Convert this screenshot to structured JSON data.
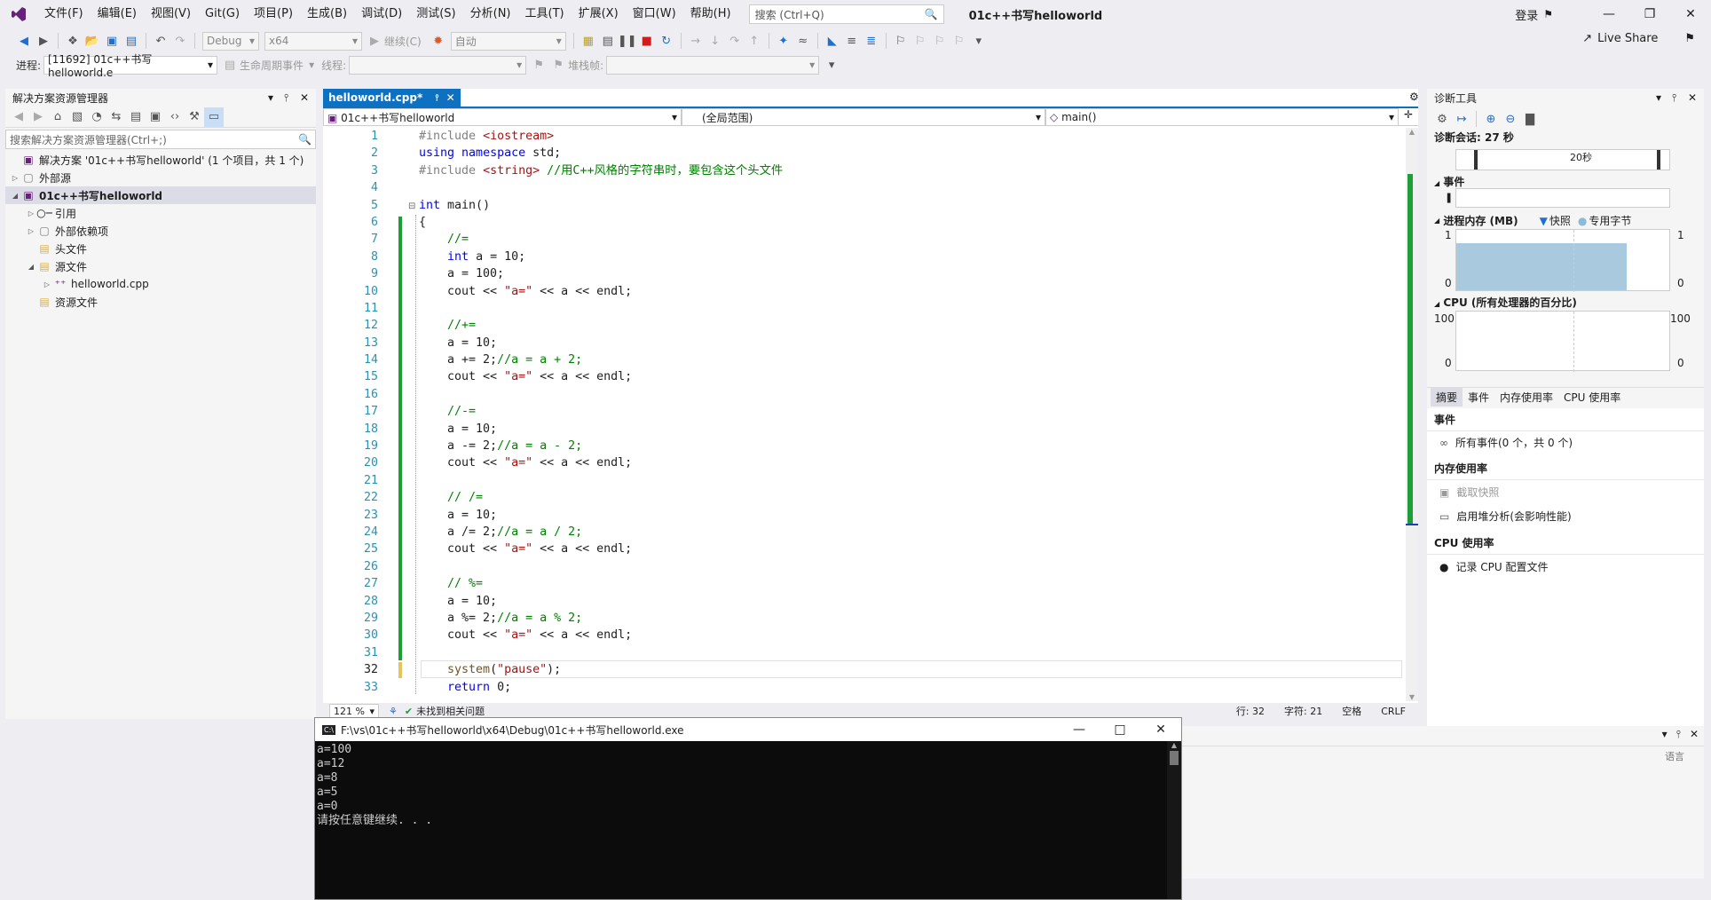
{
  "menubar": {
    "items": [
      "文件(F)",
      "编辑(E)",
      "视图(V)",
      "Git(G)",
      "项目(P)",
      "生成(B)",
      "调试(D)",
      "测试(S)",
      "分析(N)",
      "工具(T)",
      "扩展(X)",
      "窗口(W)",
      "帮助(H)"
    ],
    "search_placeholder": "搜索 (Ctrl+Q)",
    "title": "01c++书写helloworld",
    "signin": "登录",
    "live_share": "Live Share"
  },
  "toolbar": {
    "config": "Debug",
    "platform": "x64",
    "continue": "继续(C)",
    "auto": "自动"
  },
  "toolbar2": {
    "process_label": "进程:",
    "process_value": "[11692] 01c++书写helloworld.e",
    "lifecycle": "生命周期事件",
    "thread_label": "线程:",
    "stack_label": "堆栈帧:"
  },
  "solution": {
    "header": "解决方案资源管理器",
    "search_placeholder": "搜索解决方案资源管理器(Ctrl+;)",
    "items": [
      {
        "label": "解决方案 '01c++书写helloworld' (1 个项目，共 1 个)",
        "indent": 0,
        "arrow": ""
      },
      {
        "label": "外部源",
        "indent": 0,
        "arrow": "▷"
      },
      {
        "label": "01c++书写helloworld",
        "indent": 0,
        "arrow": "◢",
        "bold": true
      },
      {
        "label": "引用",
        "indent": 1,
        "arrow": "▷"
      },
      {
        "label": "外部依赖项",
        "indent": 1,
        "arrow": "▷"
      },
      {
        "label": "头文件",
        "indent": 1,
        "arrow": ""
      },
      {
        "label": "源文件",
        "indent": 1,
        "arrow": "◢"
      },
      {
        "label": "helloworld.cpp",
        "indent": 2,
        "arrow": "▷"
      },
      {
        "label": "资源文件",
        "indent": 1,
        "arrow": ""
      }
    ]
  },
  "editor": {
    "tab": "helloworld.cpp*",
    "nav_project": "01c++书写helloworld",
    "nav_scope": "(全局范围)",
    "nav_func": "main()",
    "zoom": "121 %",
    "issues": "未找到相关问题",
    "line": "行: 32",
    "char": "字符: 21",
    "space": "空格",
    "crlf": "CRLF"
  },
  "code": [
    "#include <iostream>",
    "using namespace std;",
    "#include <string> //用C++风格的字符串时，要包含这个头文件",
    "",
    "int main()",
    "{",
    "    //=",
    "    int a = 10;",
    "    a = 100;",
    "    cout << \"a=\" << a << endl;",
    "",
    "    //+=",
    "    a = 10;",
    "    a += 2;//a = a + 2;",
    "    cout << \"a=\" << a << endl;",
    "",
    "    //-=",
    "    a = 10;",
    "    a -= 2;//a = a - 2;",
    "    cout << \"a=\" << a << endl;",
    "",
    "    // /=",
    "    a = 10;",
    "    a /= 2;//a = a / 2;",
    "    cout << \"a=\" << a << endl;",
    "",
    "    // %=",
    "    a = 10;",
    "    a %= 2;//a = a % 2;",
    "    cout << \"a=\" << a << endl;",
    "",
    "    system(\"pause\");",
    "    return 0;"
  ],
  "diag": {
    "header": "诊断工具",
    "session": "诊断会话: 27 秒",
    "tick": "20秒",
    "events": "事件",
    "memory": "进程内存 (MB)",
    "snapshot": "快照",
    "private": "专用字节",
    "mem_max": "1",
    "mem_min": "0",
    "mem_fill": 0.75,
    "cpu": "CPU (所有处理器的百分比)",
    "cpu_max": "100",
    "cpu_min": "0",
    "tabs": [
      "摘要",
      "事件",
      "内存使用率",
      "CPU 使用率"
    ],
    "s_events": "事件",
    "all_events": "所有事件(0 个，共 0 个)",
    "s_mem": "内存使用率",
    "take_snapshot": "截取快照",
    "heap": "启用堆分析(会影响性能)",
    "s_cpu": "CPU 使用率",
    "record_cpu": "记录 CPU 配置文件"
  },
  "console": {
    "title": "F:\\vs\\01c++书写helloworld\\x64\\Debug\\01c++书写helloworld.exe",
    "lines": [
      "a=100",
      "a=12",
      "a=8",
      "a=5",
      "a=0",
      "请按任意键继续. . ."
    ]
  },
  "bottom": {
    "lang": "语言"
  }
}
